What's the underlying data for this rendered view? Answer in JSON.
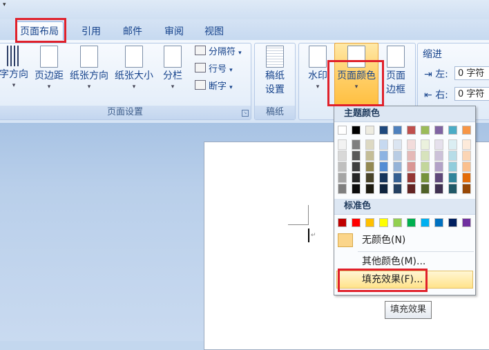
{
  "tabs": [
    "页面布局",
    "引用",
    "邮件",
    "审阅",
    "视图"
  ],
  "ribbon": {
    "page_setup": {
      "label": "页面设置",
      "buttons": [
        "字方向",
        "页边距",
        "纸张方向",
        "纸张大小",
        "分栏"
      ],
      "small": [
        "分隔符",
        "行号",
        "断字"
      ]
    },
    "draft": {
      "label": "稿纸",
      "button": "稿纸设置"
    },
    "background": {
      "watermark": "水印",
      "page_color": "页面颜色",
      "page_border": "页面边框"
    },
    "indent": {
      "title": "缩进",
      "left_label": "左:",
      "left_value": "0 字符",
      "right_label": "右:",
      "right_value": "0 字符"
    }
  },
  "dropdown": {
    "theme_header": "主题颜色",
    "standard_header": "标准色",
    "no_color": "无颜色(N)",
    "more_colors": "其他颜色(M)...",
    "fill_effects": "填充效果(F)...",
    "theme_top_row": [
      "#ffffff",
      "#000000",
      "#eeece1",
      "#1f497d",
      "#4f81bd",
      "#c0504d",
      "#9bbb59",
      "#8064a2",
      "#4bacc6",
      "#f79646"
    ],
    "theme_shades": [
      [
        "#f2f2f2",
        "#7f7f7f",
        "#ddd9c3",
        "#c6d9f0",
        "#dbe5f1",
        "#f2dcdb",
        "#ebf1dd",
        "#e5e0ec",
        "#dbeef3",
        "#fdeada"
      ],
      [
        "#d8d8d8",
        "#595959",
        "#c4bd97",
        "#8db3e2",
        "#b8cce4",
        "#e5b9b7",
        "#d7e3bc",
        "#ccc1d9",
        "#b7dde8",
        "#fbd5b5"
      ],
      [
        "#bfbfbf",
        "#3f3f3f",
        "#938953",
        "#548dd4",
        "#95b3d7",
        "#d99694",
        "#c3d69b",
        "#b2a2c7",
        "#92cddc",
        "#fac08f"
      ],
      [
        "#a5a5a5",
        "#262626",
        "#494429",
        "#17365d",
        "#366092",
        "#953734",
        "#76923c",
        "#5f497a",
        "#31859b",
        "#e36c09"
      ],
      [
        "#7f7f7f",
        "#0c0c0c",
        "#1d1b10",
        "#0f243e",
        "#244061",
        "#632423",
        "#4f6128",
        "#3f3151",
        "#205867",
        "#974806"
      ]
    ],
    "standard": [
      "#c00000",
      "#ff0000",
      "#ffc000",
      "#ffff00",
      "#92d050",
      "#00b050",
      "#00b0f0",
      "#0070c0",
      "#002060",
      "#7030a0"
    ],
    "no_color_swatch": "#fbd58a"
  },
  "tooltip": "填充效果"
}
